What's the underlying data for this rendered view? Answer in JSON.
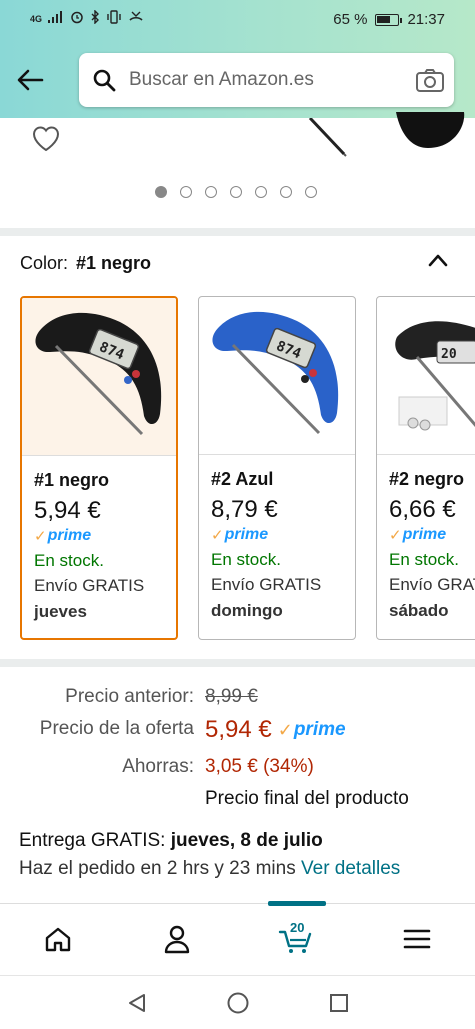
{
  "status_bar": {
    "network": "4G",
    "battery_text": "65 %",
    "battery_level": 0.65,
    "time": "21:37"
  },
  "search": {
    "placeholder": "Buscar en Amazon.es"
  },
  "carousel": {
    "dot_count": 7,
    "active_index": 0
  },
  "color_selector": {
    "label": "Color:",
    "selected": "#1 negro"
  },
  "swatches": [
    {
      "name": "#1 negro",
      "price": "5,94 €",
      "prime": "prime",
      "stock": "En stock.",
      "shipping": "Envío GRATIS",
      "day": "jueves",
      "color": "#1a1a1a"
    },
    {
      "name": "#2 Azul",
      "price": "8,79 €",
      "prime": "prime",
      "stock": "En stock.",
      "shipping": "Envío GRATIS",
      "day": "domingo",
      "color": "#2a62c9"
    },
    {
      "name": "#2 negro",
      "price": "6,66 €",
      "prime": "prime",
      "stock": "En stock.",
      "shipping": "Envío GRATIS",
      "day": "sábado",
      "color": "#222222"
    }
  ],
  "pricing": {
    "previous_label": "Precio anterior:",
    "previous_value": "8,99 €",
    "deal_label": "Precio de la oferta",
    "deal_value": "5,94 €",
    "deal_prime": "prime",
    "savings_label": "Ahorras:",
    "savings_value": "3,05 € (34%)",
    "final_note": "Precio final del producto"
  },
  "delivery": {
    "prefix": "Entrega GRATIS:",
    "date": "jueves, 8 de julio",
    "order_text": "Haz el pedido en 2 hrs y 23 mins",
    "details_link": "Ver detalles"
  },
  "bottom_nav": {
    "cart_count": "20"
  },
  "colors": {
    "accent_orange": "#e77600",
    "price_red": "#b12704",
    "stock_green": "#007600",
    "prime_blue": "#1a98ff",
    "link_teal": "#007185"
  }
}
